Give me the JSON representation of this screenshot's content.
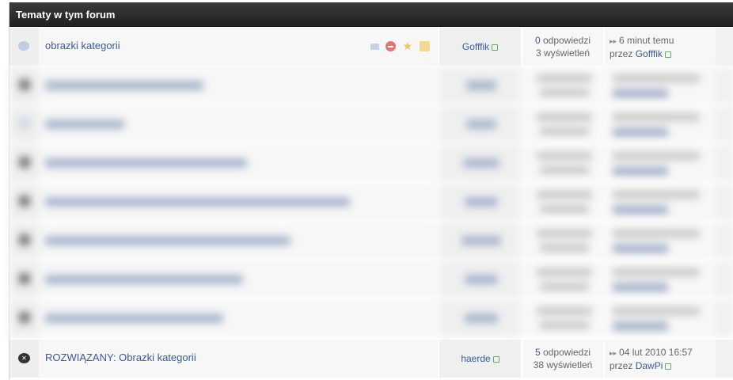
{
  "header": {
    "title": "Tematy w tym forum"
  },
  "topics": [
    {
      "title": "obrazki kategorii",
      "author": "Gofffik",
      "replies_num": "0",
      "replies_label": "odpowiedzi",
      "views": "3 wyświetleń",
      "last_time": "6 minut temu",
      "last_by_label": "przez",
      "last_by": "Gofffik"
    },
    {
      "title": "ROZWIĄZANY: Obrazki kategorii",
      "author": "haerde",
      "replies_num": "5",
      "replies_label": "odpowiedzi",
      "views": "38 wyświetleń",
      "last_time": "04 lut 2010 16:57",
      "last_by_label": "przez",
      "last_by": "DawPi"
    }
  ],
  "icons": {
    "topic_normal": "speech-bubble-icon",
    "topic_solved": "speech-bubble-x-icon",
    "tools": [
      "message-icon",
      "stop-icon",
      "star-icon",
      "lock-icon"
    ]
  },
  "colors": {
    "header_bg": "#2b2b2b",
    "link": "#3b5998"
  }
}
